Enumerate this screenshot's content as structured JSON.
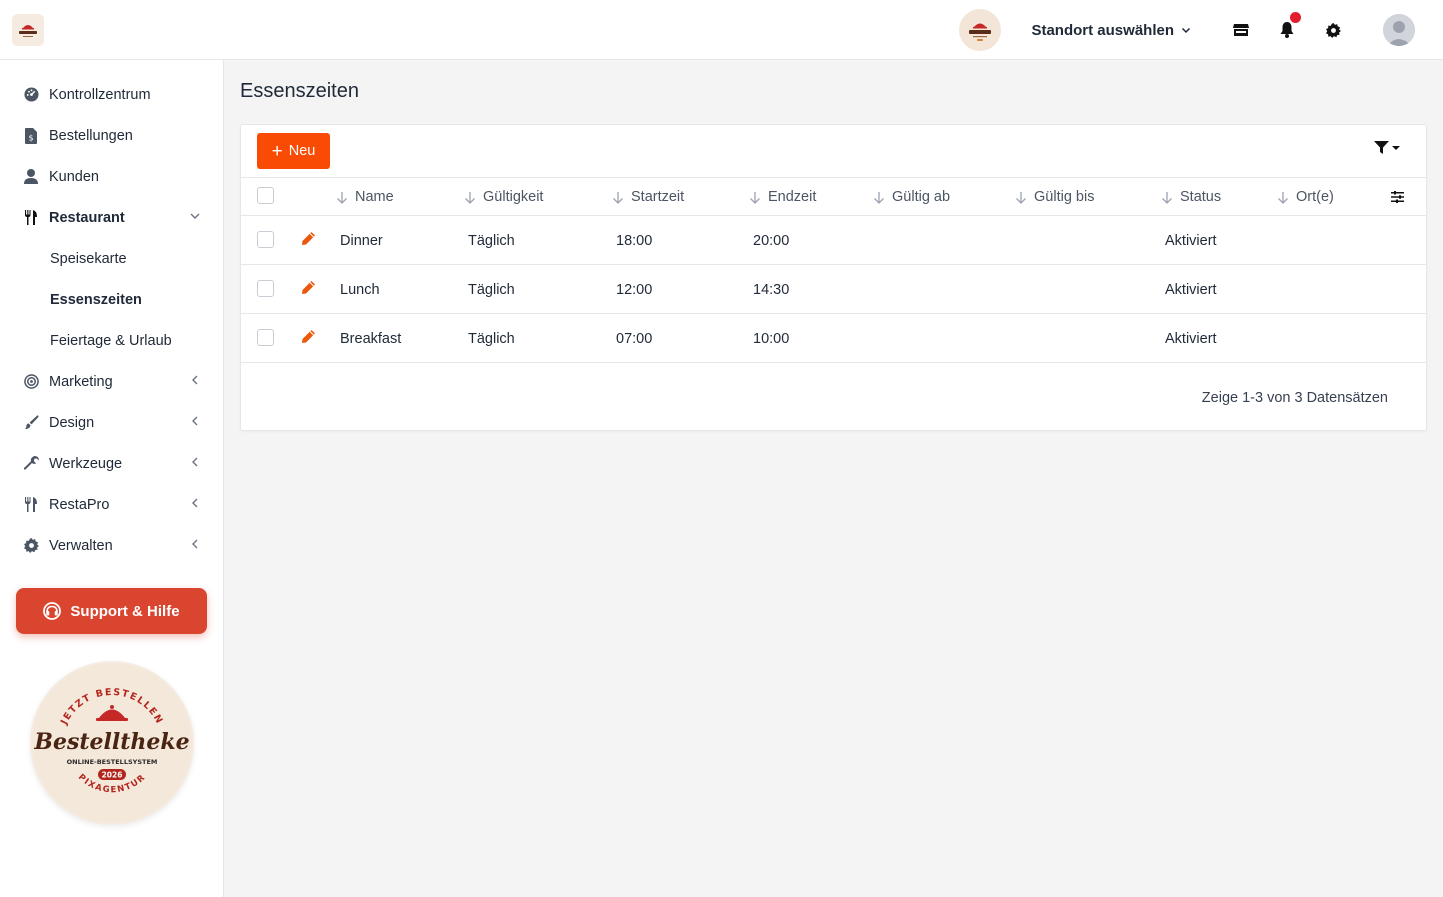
{
  "brand": {
    "badge_top": "JETZT BESTELLEN",
    "badge_name": "Bestelltheke",
    "badge_sub": "ONLINE-BESTELLSYSTEM",
    "badge_year": "2026",
    "badge_bottom": "PIXAGENTUR"
  },
  "topbar": {
    "location_label": "Standort auswählen"
  },
  "sidebar": {
    "items": [
      {
        "label": "Kontrollzentrum",
        "icon": "dashboard-icon"
      },
      {
        "label": "Bestellungen",
        "icon": "receipt-icon"
      },
      {
        "label": "Kunden",
        "icon": "user-icon"
      },
      {
        "label": "Restaurant",
        "icon": "utensils-icon"
      },
      {
        "label": "Marketing",
        "icon": "target-icon"
      },
      {
        "label": "Design",
        "icon": "brush-icon"
      },
      {
        "label": "Werkzeuge",
        "icon": "wrench-icon"
      },
      {
        "label": "RestaPro",
        "icon": "utensils-icon"
      },
      {
        "label": "Verwalten",
        "icon": "gear-icon"
      }
    ],
    "restaurant_sub": [
      "Speisekarte",
      "Essenszeiten",
      "Feiertage & Urlaub"
    ],
    "support_label": "Support & Hilfe"
  },
  "main": {
    "title": "Essenszeiten",
    "new_label": "Neu",
    "columns": [
      "Name",
      "Gültigkeit",
      "Startzeit",
      "Endzeit",
      "Gültig ab",
      "Gültig bis",
      "Status",
      "Ort(e)"
    ],
    "rows": [
      {
        "name": "Dinner",
        "validity": "Täglich",
        "start": "18:00",
        "end": "20:00",
        "from": "",
        "to": "",
        "status": "Aktiviert",
        "places": ""
      },
      {
        "name": "Lunch",
        "validity": "Täglich",
        "start": "12:00",
        "end": "14:30",
        "from": "",
        "to": "",
        "status": "Aktiviert",
        "places": ""
      },
      {
        "name": "Breakfast",
        "validity": "Täglich",
        "start": "07:00",
        "end": "10:00",
        "from": "",
        "to": "",
        "status": "Aktiviert",
        "places": ""
      }
    ],
    "footer": "Zeige 1-3 von 3 Datensätzen"
  },
  "colors": {
    "accent": "#fa4b05",
    "support": "#d9452f",
    "notification": "#e11d2e"
  }
}
